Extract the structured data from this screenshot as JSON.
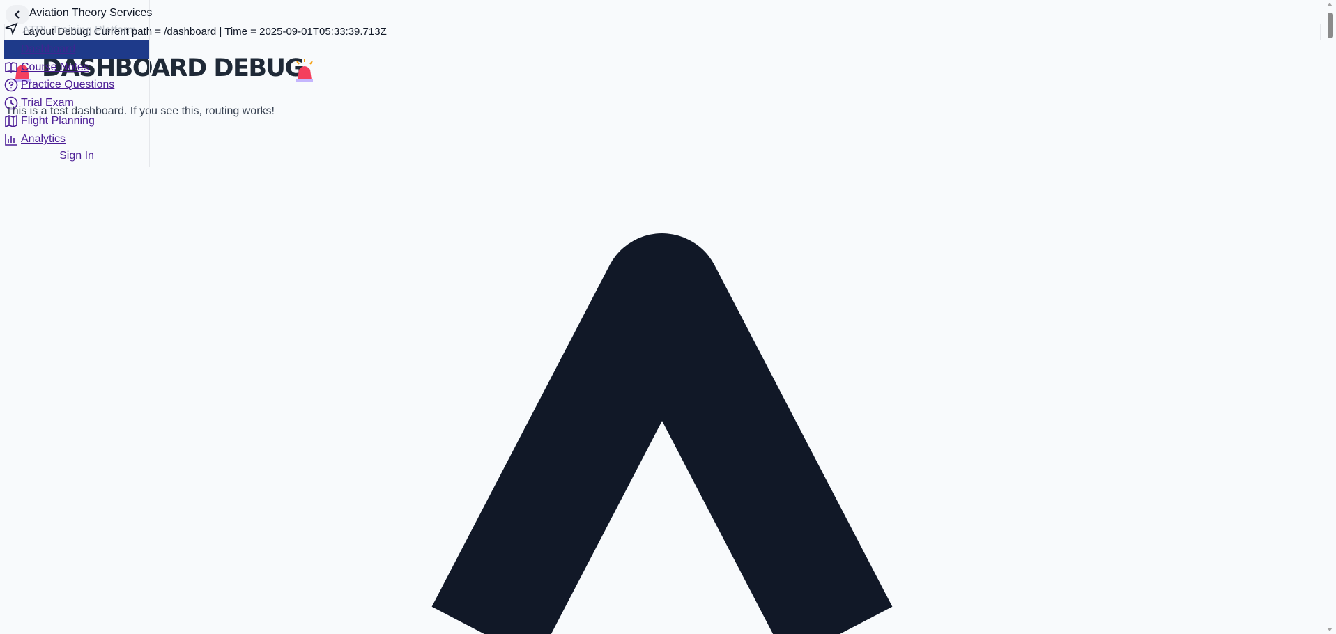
{
  "app": {
    "brand_name": "Aviation Theory Services",
    "brand_tagline": "ATPL Training Platform"
  },
  "debug": {
    "text": "Layout Debug: Current path = /dashboard | Time = 2025-09-01T05:33:39.713Z"
  },
  "main": {
    "title": "DASHBOARD DEBUG",
    "subtitle": "This is a test dashboard. If you see this, routing works!"
  },
  "sidebar": {
    "active_item": "Dashboard",
    "items": [
      {
        "label": "Course Notes",
        "icon": "book-icon"
      },
      {
        "label": "Practice Questions",
        "icon": "question-circle-icon"
      },
      {
        "label": "Trial Exam",
        "icon": "clock-icon"
      },
      {
        "label": "Flight Planning",
        "icon": "map-icon"
      },
      {
        "label": "Analytics",
        "icon": "bar-chart-icon"
      }
    ],
    "sign_in": "Sign In"
  },
  "colors": {
    "background": "#f8fafc",
    "nav_link": "#4c1d95",
    "active_bg": "#1e3a8a",
    "chevron": "#111827"
  }
}
